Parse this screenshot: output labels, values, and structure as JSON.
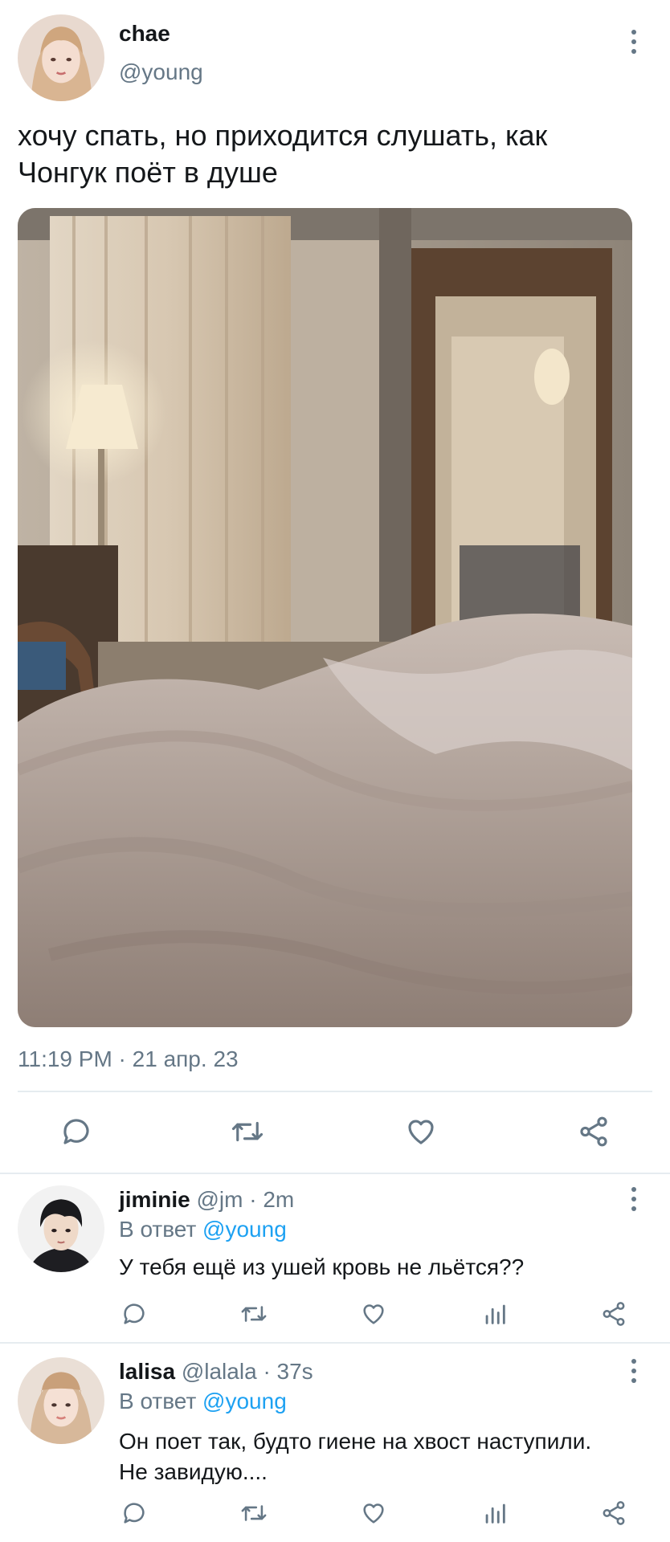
{
  "tweet": {
    "author_name": "chae",
    "author_handle": "@young",
    "text_line1": "хочу спать, но приходится слушать, как",
    "text_line2": "Чонгук поёт в душе",
    "timestamp": "11:19 PM · 21 апр. 23",
    "image_alt": "unmade hotel bed with lamp and curtains"
  },
  "actions": {
    "icons": [
      "reply-icon",
      "retweet-icon",
      "like-icon",
      "share-icon"
    ]
  },
  "replies": [
    {
      "name": "jiminie",
      "handle": "@jm",
      "time": "· 2m",
      "reply_prefix": "В ответ",
      "reply_to": "@young",
      "text_line1": "У тебя ещё из ушей кровь не льётся??",
      "text_line2": ""
    },
    {
      "name": "lalisa",
      "handle": "@lalala",
      "time": "· 37s",
      "reply_prefix": "В ответ",
      "reply_to": "@young",
      "text_line1": "Он поет так, будто гиене на хвост наступили.",
      "text_line2": "Не завидую...."
    }
  ],
  "colors": {
    "accent": "#1da1f2",
    "muted": "#657786",
    "icon": "#657786"
  }
}
